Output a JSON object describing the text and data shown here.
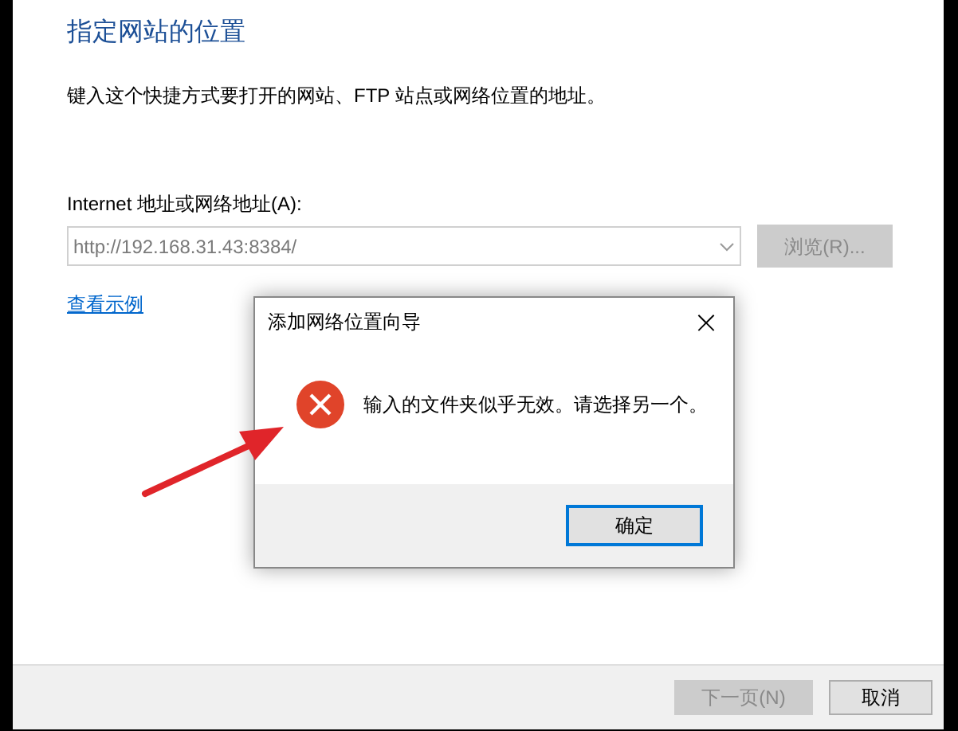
{
  "heading": "指定网站的位置",
  "description": "键入这个快捷方式要打开的网站、FTP 站点或网络位置的地址。",
  "address_label": "Internet 地址或网络地址(A):",
  "address_field": {
    "value": "http://192.168.31.43:8384/",
    "disabled": true
  },
  "browse_button": {
    "label": "浏览(R)...",
    "disabled": true
  },
  "example_link": "查看示例",
  "dialog": {
    "title": "添加网络位置向导",
    "close": "×",
    "message": "输入的文件夹似乎无效。请选择另一个。",
    "ok_button": "确定"
  },
  "footer_buttons": [
    {
      "label": "下一页(N)",
      "disabled": true
    },
    {
      "label": "取消",
      "disabled": false
    }
  ]
}
